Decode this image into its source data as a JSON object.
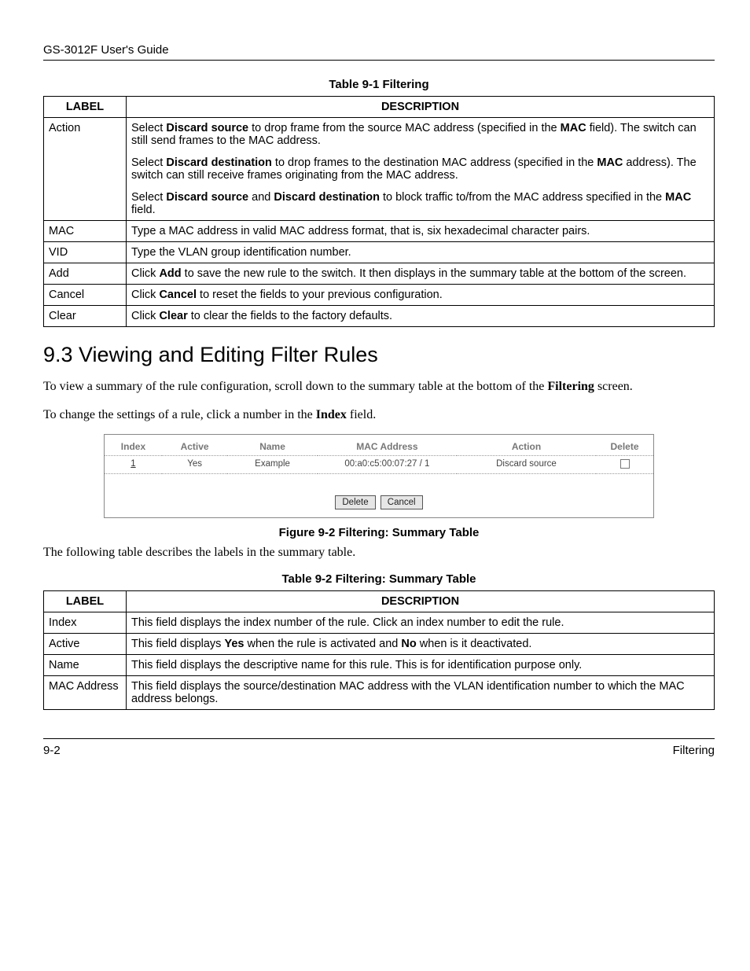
{
  "header": {
    "running_title": "GS-3012F User's Guide"
  },
  "table1": {
    "caption": "Table 9-1 Filtering",
    "th_label": "LABEL",
    "th_desc": "DESCRIPTION",
    "rows": {
      "action": {
        "label": "Action",
        "p1_a": "Select ",
        "p1_b": "Discard source",
        "p1_c": " to drop frame from the source MAC address (specified in the ",
        "p1_d": "MAC",
        "p1_e": " field). The switch can still send frames to the MAC address.",
        "p2_a": "Select ",
        "p2_b": "Discard destination",
        "p2_c": " to drop frames to the destination MAC address (specified in the ",
        "p2_d": "MAC",
        "p2_e": " address). The switch can still receive frames originating from the MAC address.",
        "p3_a": "Select ",
        "p3_b": "Discard source",
        "p3_c": " and ",
        "p3_d": "Discard destination",
        "p3_e": " to block traffic to/from the MAC address specified in the ",
        "p3_f": "MAC",
        "p3_g": " field."
      },
      "mac": {
        "label": "MAC",
        "desc": "Type a MAC address in valid MAC address format, that is, six hexadecimal character pairs."
      },
      "vid": {
        "label": "VID",
        "desc": "Type the VLAN group identification number."
      },
      "add": {
        "label": "Add",
        "a": "Click ",
        "b": "Add",
        "c": " to save the new rule to the switch. It then displays in the summary table at the bottom of the screen."
      },
      "cancel": {
        "label": "Cancel",
        "a": "Click ",
        "b": "Cancel",
        "c": " to reset the fields to your previous configuration."
      },
      "clear": {
        "label": "Clear",
        "a": "Click ",
        "b": "Clear",
        "c": " to clear the fields to the factory defaults."
      }
    }
  },
  "section": {
    "heading": "9.3  Viewing and Editing Filter Rules",
    "p1_a": "To view a summary of the rule configuration, scroll down to the summary table at the bottom of the ",
    "p1_b": "Filtering",
    "p1_c": " screen.",
    "p2_a": "To change the settings of a rule, click a number in the ",
    "p2_b": "Index",
    "p2_c": " field."
  },
  "figure": {
    "cols": {
      "index": "Index",
      "active": "Active",
      "name": "Name",
      "mac": "MAC Address",
      "action": "Action",
      "delete": "Delete"
    },
    "row": {
      "index": "1",
      "active": "Yes",
      "name": "Example",
      "mac": "00:a0:c5:00:07:27 / 1",
      "action": "Discard source"
    },
    "buttons": {
      "delete": "Delete",
      "cancel": "Cancel"
    },
    "caption": "Figure 9-2 Filtering: Summary Table"
  },
  "p_after_figure": "The following table describes the labels in the summary table.",
  "table2": {
    "caption": "Table 9-2 Filtering: Summary Table",
    "th_label": "LABEL",
    "th_desc": "DESCRIPTION",
    "rows": {
      "index": {
        "label": "Index",
        "desc": "This field displays the index number of the rule. Click an index number to edit the rule."
      },
      "active": {
        "label": "Active",
        "a": "This field displays ",
        "b": "Yes",
        "c": " when the rule is activated and ",
        "d": "No",
        "e": " when is it deactivated."
      },
      "name": {
        "label": "Name",
        "desc": "This field displays the descriptive name for this rule. This is for identification purpose only."
      },
      "mac": {
        "label": "MAC Address",
        "desc": "This field displays the source/destination MAC address with the VLAN identification number to which the MAC address belongs."
      }
    }
  },
  "footer": {
    "left": "9-2",
    "right": "Filtering"
  }
}
